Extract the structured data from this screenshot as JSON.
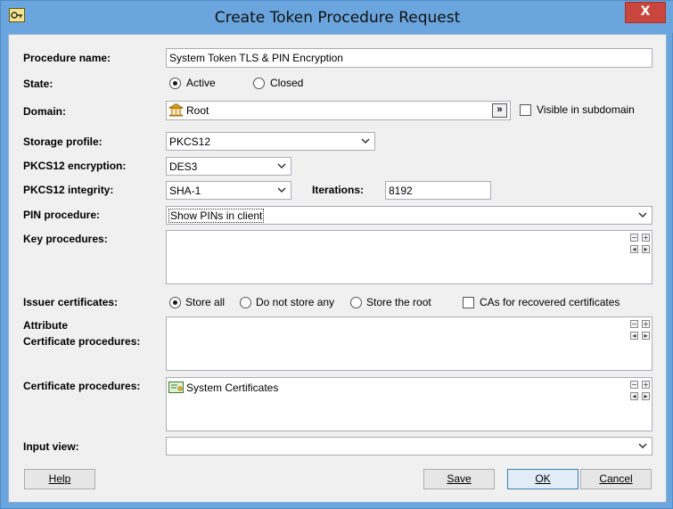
{
  "window": {
    "title": "Create Token Procedure Request",
    "close_label": "X"
  },
  "labels": {
    "procedure_name": "Procedure name:",
    "state": "State:",
    "domain": "Domain:",
    "storage_profile": "Storage profile:",
    "pkcs12_encryption": "PKCS12 encryption:",
    "pkcs12_integrity": "PKCS12 integrity:",
    "iterations": "Iterations:",
    "pin_procedure": "PIN procedure:",
    "key_procedures": "Key procedures:",
    "issuer_certificates": "Issuer certificates:",
    "attribute_line1": "Attribute",
    "attribute_line2": "Certificate procedures:",
    "certificate_procedures": "Certificate procedures:",
    "input_view": "Input view:"
  },
  "fields": {
    "procedure_name": "System Token TLS & PIN Encryption",
    "domain": "Root",
    "domain_browse": "»",
    "storage_profile": "PKCS12",
    "pkcs12_encryption": "DES3",
    "pkcs12_integrity": "SHA-1",
    "iterations": "8192",
    "pin_procedure": "Show PINs in client",
    "input_view": ""
  },
  "state": {
    "options": [
      "Active",
      "Closed"
    ],
    "selected": "Active"
  },
  "visible_in_subdomain": {
    "label": "Visible in subdomain",
    "checked": false
  },
  "issuer_certificates": {
    "options": [
      "Store all",
      "Do not store any",
      "Store the root"
    ],
    "selected": "Store all",
    "cas_label": "CAs for recovered certificates",
    "cas_checked": false
  },
  "certificate_procedures": {
    "items": [
      "System Certificates"
    ]
  },
  "list_controls": {
    "minus": "−",
    "plus": "+",
    "left": "◂",
    "right": "▸"
  },
  "buttons": {
    "help": "Help",
    "save": "Save",
    "ok": "OK",
    "cancel": "Cancel"
  },
  "icons": {
    "app": "key-app-icon",
    "domain": "bank-building-icon",
    "certificate": "certificate-icon",
    "dropdown": "chevron-down-icon"
  }
}
